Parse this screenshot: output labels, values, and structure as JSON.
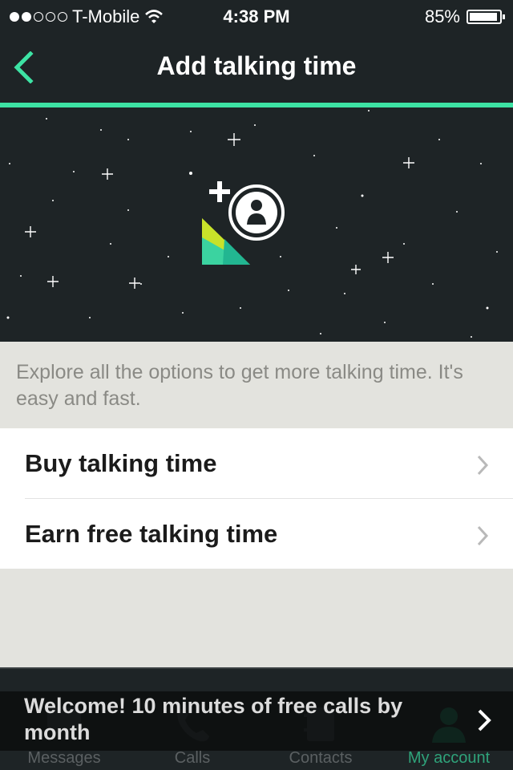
{
  "status_bar": {
    "carrier": "T-Mobile",
    "signal_dots_filled": 2,
    "signal_dots_total": 5,
    "time": "4:38 PM",
    "battery": "85%",
    "battery_level": 0.85
  },
  "nav": {
    "title": "Add talking time",
    "back_icon": "chevron-left-icon"
  },
  "intro": {
    "text": "Explore all the options to get more talking time. It's easy and fast."
  },
  "options": [
    {
      "label": "Buy talking time",
      "icon": "chevron-right-icon"
    },
    {
      "label": "Earn free talking time",
      "icon": "chevron-right-icon"
    }
  ],
  "tabs": [
    {
      "label": "Messages",
      "icon": "chat-bubble-icon",
      "active": false
    },
    {
      "label": "Calls",
      "icon": "phone-icon",
      "active": false
    },
    {
      "label": "Contacts",
      "icon": "contacts-book-icon",
      "active": false
    },
    {
      "label": "My account",
      "icon": "person-icon",
      "active": true
    }
  ],
  "banner": {
    "text": "Welcome! 10 minutes of free calls by month",
    "icon": "chevron-right-icon"
  },
  "colors": {
    "accent": "#3de3a4",
    "dark_background": "#1e2426",
    "light_background": "#e3e3de"
  }
}
